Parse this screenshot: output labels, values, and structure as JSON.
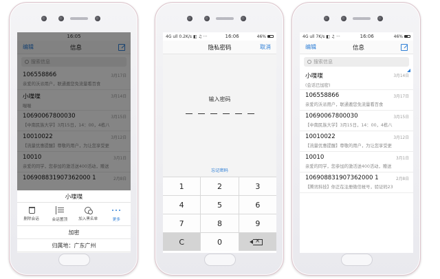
{
  "phone1": {
    "status": {
      "left": "",
      "time": "16:05",
      "battery": ""
    },
    "nav": {
      "edit": "编辑",
      "title": "信息"
    },
    "search_placeholder": "搜索信息",
    "messages": [
      {
        "name": "106558866",
        "preview": "亲爱的沃派用户，联通邀您免流量看百食",
        "date": "3月17日"
      },
      {
        "name": "小喋喋",
        "preview": "喔喔",
        "date": "3月14日"
      },
      {
        "name": "10690067800030",
        "preview": "【中南民族大学】3月15日，14：00，4栋八",
        "date": "3月15日"
      },
      {
        "name": "10010022",
        "preview": "【流量优惠提醒】尊敬的用户，为让您享受更",
        "date": "3月12日"
      },
      {
        "name": "10010",
        "preview": "亲爱的同学，您参加的激活送400活动，赠送",
        "date": "3月1日"
      },
      {
        "name": "106908831907362000 1",
        "preview": "",
        "date": "2月8日"
      }
    ],
    "sheet": {
      "title": "小喋喋",
      "actions": [
        {
          "label": "删除会话",
          "icon": "trash-icon"
        },
        {
          "label": "会话置顶",
          "icon": "pin-icon"
        },
        {
          "label": "加入黑名单",
          "icon": "blacklist-icon"
        },
        {
          "label": "更多",
          "icon": "more-icon"
        }
      ],
      "encrypt": "加密",
      "location": "归属地：广东广州"
    }
  },
  "phone2": {
    "status": {
      "left": "4G ull 0.2K/s ◧ ♫ ···",
      "time": "16:06",
      "battery": "46%"
    },
    "nav": {
      "title": "隐私密码",
      "cancel": "取消"
    },
    "prompt": "输入密码",
    "forgot": "忘记密码",
    "keys": [
      "1",
      "2",
      "3",
      "4",
      "5",
      "6",
      "7",
      "8",
      "9",
      "C",
      "0",
      ""
    ]
  },
  "phone3": {
    "status": {
      "left": "4G ull 7K/s ◧ ♫ ···",
      "time": "16:06",
      "battery": "46%"
    },
    "nav": {
      "edit": "编辑",
      "title": "信息"
    },
    "search_placeholder": "搜索信息",
    "messages": [
      {
        "name": "小喋喋",
        "preview": "(会话已加密)",
        "date": "3月14日"
      },
      {
        "name": "106558866",
        "preview": "亲爱的沃派用户，联通邀您免流量看百食",
        "date": "3月17日"
      },
      {
        "name": "10690067800030",
        "preview": "【中南民族大学】3月15日，14：00，4栋八",
        "date": "3月15日"
      },
      {
        "name": "10010022",
        "preview": "【流量优惠提醒】尊敬的用户，为让您享受更",
        "date": "3月12日"
      },
      {
        "name": "10010",
        "preview": "亲爱的同学，您参加的激活送400活动，赠送",
        "date": "3月1日"
      },
      {
        "name": "106908831907362000 1",
        "preview": "【腾讯科技】你正在注册微信帐号，验证码23",
        "date": "2月8日"
      }
    ]
  }
}
